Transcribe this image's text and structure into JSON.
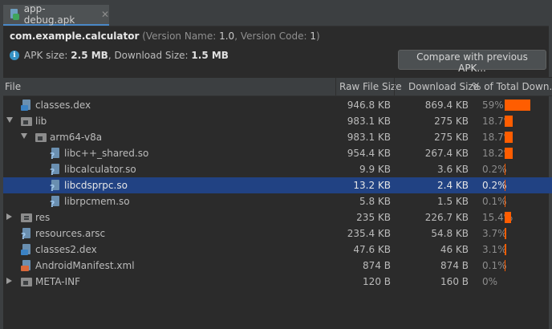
{
  "tab": {
    "title": "app-debug.apk",
    "close": "✕"
  },
  "summary": {
    "package": "com.example.calculator",
    "version_prefix": "(Version Name: ",
    "version_name": "1.0",
    "version_mid": ", Version Code: ",
    "version_code": "1",
    "version_suffix": ")",
    "apk_size_label": "APK size: ",
    "apk_size": "2.5 MB",
    "download_size_label": ", Download Size: ",
    "download_size": "1.5 MB"
  },
  "compare_button": "Compare with previous APK...",
  "columns": {
    "file": "File",
    "raw": "Raw File Size",
    "download": "Download Size",
    "percent": "% of Total Down..."
  },
  "rows": [
    {
      "name": "classes.dex",
      "raw": "946.8 KB",
      "download": "869.4 KB",
      "percent": "59%",
      "share": 0.59,
      "icon": "dex-file-icon",
      "depth": 0,
      "expander": "none"
    },
    {
      "name": "lib",
      "raw": "983.1 KB",
      "download": "275 KB",
      "percent": "18.7%",
      "share": 0.187,
      "icon": "folder-icon",
      "depth": 0,
      "expander": "expanded"
    },
    {
      "name": "arm64-v8a",
      "raw": "983.1 KB",
      "download": "275 KB",
      "percent": "18.7%",
      "share": 0.187,
      "icon": "folder-icon",
      "depth": 1,
      "expander": "expanded"
    },
    {
      "name": "libc++_shared.so",
      "raw": "954.4 KB",
      "download": "267.4 KB",
      "percent": "18.2%",
      "share": 0.182,
      "icon": "unknown-file-icon",
      "depth": 2,
      "expander": "none"
    },
    {
      "name": "libcalculator.so",
      "raw": "9.9 KB",
      "download": "3.6 KB",
      "percent": "0.2%",
      "share": 0.002,
      "icon": "unknown-file-icon",
      "depth": 2,
      "expander": "none"
    },
    {
      "name": "libcdsprpc.so",
      "raw": "13.2 KB",
      "download": "2.4 KB",
      "percent": "0.2%",
      "share": 0.002,
      "icon": "unknown-file-icon",
      "depth": 2,
      "expander": "none",
      "selected": true
    },
    {
      "name": "librpcmem.so",
      "raw": "5.8 KB",
      "download": "1.5 KB",
      "percent": "0.1%",
      "share": 0.001,
      "icon": "unknown-file-icon",
      "depth": 2,
      "expander": "none"
    },
    {
      "name": "res",
      "raw": "235 KB",
      "download": "226.7 KB",
      "percent": "15.4%",
      "share": 0.154,
      "icon": "res-folder-icon",
      "depth": 0,
      "expander": "collapsed"
    },
    {
      "name": "resources.arsc",
      "raw": "235.4 KB",
      "download": "54.8 KB",
      "percent": "3.7%",
      "share": 0.037,
      "icon": "unknown-file-icon",
      "depth": 0,
      "expander": "none"
    },
    {
      "name": "classes2.dex",
      "raw": "47.6 KB",
      "download": "46 KB",
      "percent": "3.1%",
      "share": 0.031,
      "icon": "dex-file-icon",
      "depth": 0,
      "expander": "none"
    },
    {
      "name": "AndroidManifest.xml",
      "raw": "874 B",
      "download": "874 B",
      "percent": "0.1%",
      "share": 0.001,
      "icon": "xml-file-icon",
      "depth": 0,
      "expander": "none"
    },
    {
      "name": "META-INF",
      "raw": "120 B",
      "download": "160 B",
      "percent": "0%",
      "share": 0,
      "icon": "folder-icon",
      "depth": 0,
      "expander": "collapsed"
    }
  ]
}
